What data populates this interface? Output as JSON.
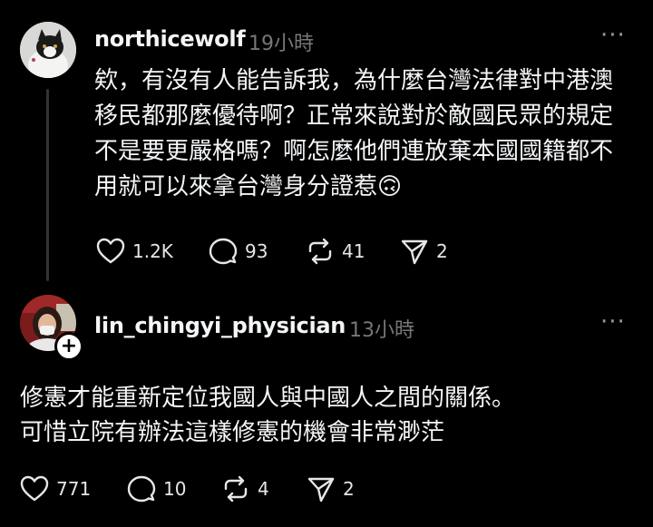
{
  "post": {
    "username": "northicewolf",
    "time": "19小時",
    "more": "···",
    "lines": [
      "欸，有沒有人能告訴我，為什麼台灣法律對中港澳",
      "移民都那麼優待啊？正常來說對於敵國民眾的規定",
      "不是要更嚴格嗎？啊怎麼他們連放棄本國國籍都不",
      "用就可以來拿台灣身分證惹🙃"
    ],
    "likes": "1.2K",
    "comments": "93",
    "reposts": "41",
    "shares": "2"
  },
  "reply": {
    "username": "lin_chingyi_physician",
    "time": "13小時",
    "more": "···",
    "follow": "+",
    "lines": [
      "修憲才能重新定位我國人與中國人之間的關係。",
      "可惜立院有辦法這樣修憲的機會非常渺茫"
    ],
    "likes": "771",
    "comments": "10",
    "reposts": "4",
    "shares": "2"
  }
}
